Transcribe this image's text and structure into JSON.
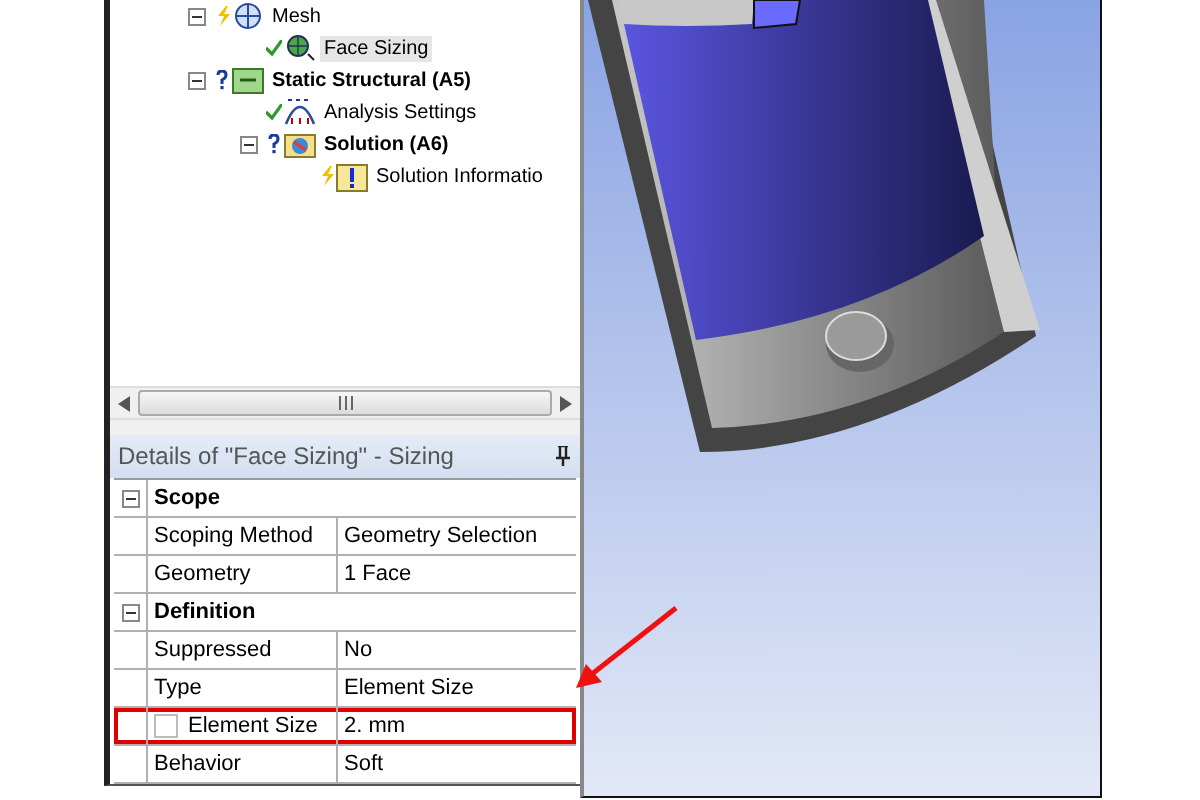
{
  "tree": [
    {
      "label": "Mesh",
      "kind": "mesh",
      "defined": true,
      "up_to_date": false,
      "expanded": true,
      "selected": false,
      "children": [
        {
          "label": "Face Sizing",
          "kind": "sizing",
          "defined": true,
          "up_to_date": true,
          "selected": true
        }
      ]
    },
    {
      "label": "Static Structural (A5)",
      "kind": "environment",
      "defined": false,
      "expanded": true,
      "selected": false,
      "children": [
        {
          "label": "Analysis Settings",
          "kind": "settings",
          "defined": true,
          "up_to_date": true,
          "selected": false
        },
        {
          "label": "Solution (A6)",
          "kind": "solution",
          "defined": false,
          "expanded": true,
          "selected": false,
          "children": [
            {
              "label": "Solution Informatio",
              "kind": "info",
              "defined": true,
              "up_to_date": false,
              "selected": false
            }
          ]
        }
      ]
    }
  ],
  "details": {
    "title": "Details of \"Face Sizing\" - Sizing",
    "sections": [
      {
        "title": "Scope",
        "expanded": true,
        "rows": [
          {
            "kind": "plain",
            "name": "Scoping Method",
            "value": "Geometry Selection",
            "highlighted": false
          },
          {
            "kind": "plain",
            "name": "Geometry",
            "value": "1 Face",
            "highlighted": false
          }
        ]
      },
      {
        "title": "Definition",
        "expanded": true,
        "rows": [
          {
            "kind": "plain",
            "name": "Suppressed",
            "value": "No",
            "highlighted": false
          },
          {
            "kind": "plain",
            "name": "Type",
            "value": "Element Size",
            "highlighted": false
          },
          {
            "kind": "checkbox",
            "name": "Element Size",
            "value": "2. mm",
            "checked": false,
            "highlighted": true
          },
          {
            "kind": "plain",
            "name": "Behavior",
            "value": "Soft",
            "highlighted": false
          }
        ]
      }
    ]
  }
}
